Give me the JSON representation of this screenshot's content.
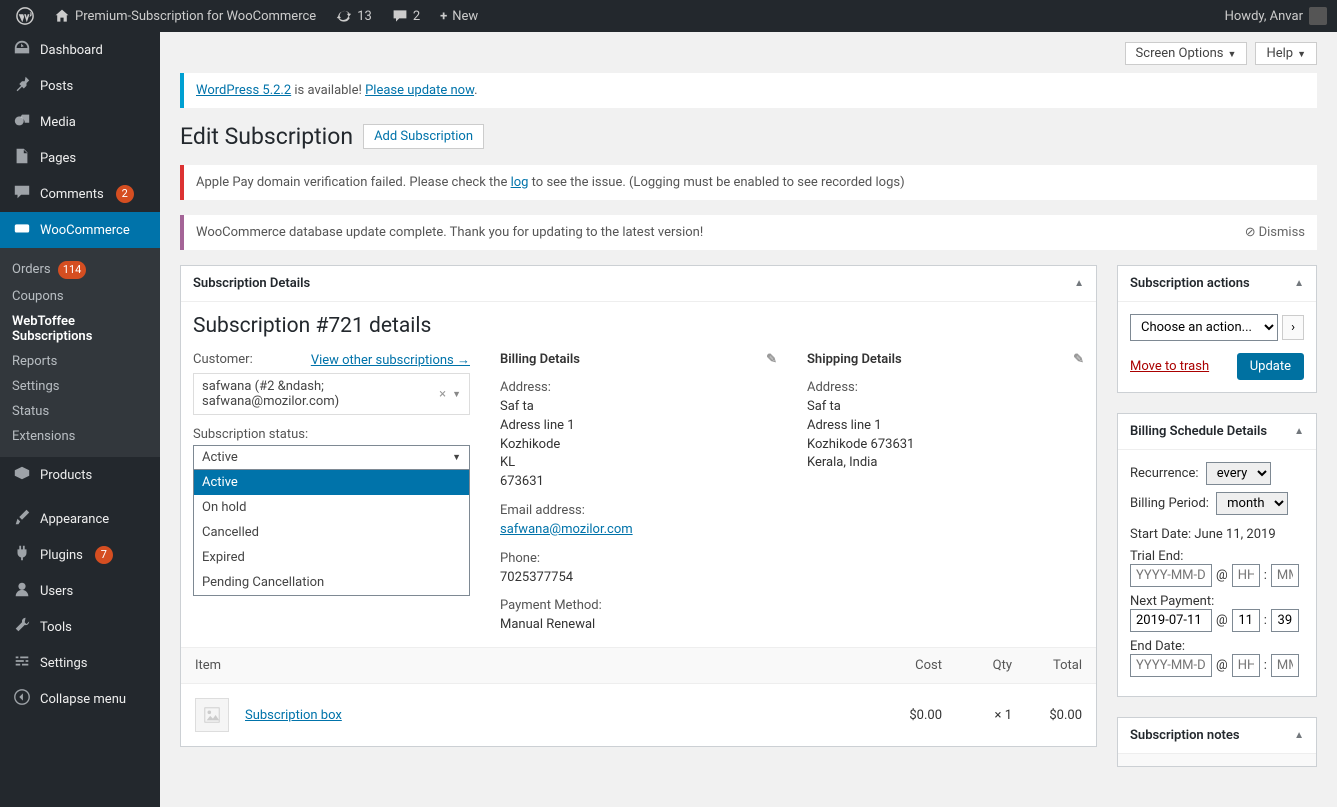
{
  "topbar": {
    "site": "Premium-Subscription for WooCommerce",
    "updates": "13",
    "comments": "2",
    "new": "New",
    "howdy": "Howdy, Anvar"
  },
  "menu": {
    "dashboard": "Dashboard",
    "posts": "Posts",
    "media": "Media",
    "pages": "Pages",
    "comments": "Comments",
    "comments_badge": "2",
    "woocommerce": "WooCommerce",
    "sub": {
      "orders": "Orders",
      "orders_badge": "114",
      "coupons": "Coupons",
      "webtoffee": "WebToffee Subscriptions",
      "reports": "Reports",
      "settings": "Settings",
      "status": "Status",
      "extensions": "Extensions"
    },
    "products": "Products",
    "appearance": "Appearance",
    "plugins": "Plugins",
    "plugins_badge": "7",
    "users": "Users",
    "tools": "Tools",
    "settings": "Settings",
    "collapse": "Collapse menu"
  },
  "soh": {
    "screen": "Screen Options",
    "help": "Help"
  },
  "notice_update": {
    "a": "WordPress 5.2.2",
    "b": " is available! ",
    "c": "Please update now",
    "d": "."
  },
  "heading": {
    "h": "Edit Subscription",
    "add": "Add Subscription"
  },
  "notice_apple": {
    "a": "Apple Pay domain verification failed. Please check the ",
    "b": "log",
    "c": " to see the issue. (Logging must be enabled to see recorded logs)"
  },
  "notice_db": {
    "msg": "WooCommerce database update complete. Thank you for updating to the latest version!",
    "dismiss": "Dismiss"
  },
  "box_details": {
    "title": "Subscription Details"
  },
  "subd": {
    "title": "Subscription #721 details",
    "customer_label": "Customer:",
    "other_subs": "View other subscriptions →",
    "customer_val": "safwana (#2 &ndash; safwana@mozilor.com)",
    "status_label": "Subscription status:",
    "status_selected": "Active",
    "status_opts": [
      "Active",
      "On hold",
      "Cancelled",
      "Expired",
      "Pending Cancellation"
    ]
  },
  "billing": {
    "header": "Billing Details",
    "addr_label": "Address:",
    "l1": "Saf ta",
    "l2": "Adress line 1",
    "l3": "Kozhikode",
    "l4": "KL",
    "l5": "673631",
    "email_label": "Email address:",
    "email": "safwana@mozilor.com",
    "phone_label": "Phone:",
    "phone": "7025377754",
    "pay_label": "Payment Method:",
    "pay": "Manual Renewal"
  },
  "shipping": {
    "header": "Shipping Details",
    "addr_label": "Address:",
    "l1": "Saf ta",
    "l2": "Adress line 1",
    "l3": "Kozhikode 673631",
    "l4": "Kerala, India"
  },
  "items": {
    "h_item": "Item",
    "h_cost": "Cost",
    "h_qty": "Qty",
    "h_total": "Total",
    "name": "Subscription box",
    "cost": "$0.00",
    "qty_x": "×  1",
    "total": "$0.00"
  },
  "side_actions": {
    "title": "Subscription actions",
    "choose": "Choose an action...",
    "trash": "Move to trash",
    "update": "Update"
  },
  "sched": {
    "title": "Billing Schedule Details",
    "rec_label": "Recurrence:",
    "rec_val": "every",
    "bp_label": "Billing Period:",
    "bp_val": "month",
    "start_label": "Start Date: ",
    "start_val": "June 11, 2019",
    "trial_label": "Trial End:",
    "trial_date": "YYYY-MM-DD",
    "trial_hh": "HH",
    "trial_mm": "MM",
    "next_label": "Next Payment:",
    "next_date": "2019-07-11",
    "next_hh": "11",
    "next_mm": "39",
    "end_label": "End Date:",
    "end_date": "YYYY-MM-DD",
    "end_hh": "HH",
    "end_mm": "MM",
    "at": "@",
    "colon": ":"
  },
  "notes": {
    "title": "Subscription notes"
  }
}
